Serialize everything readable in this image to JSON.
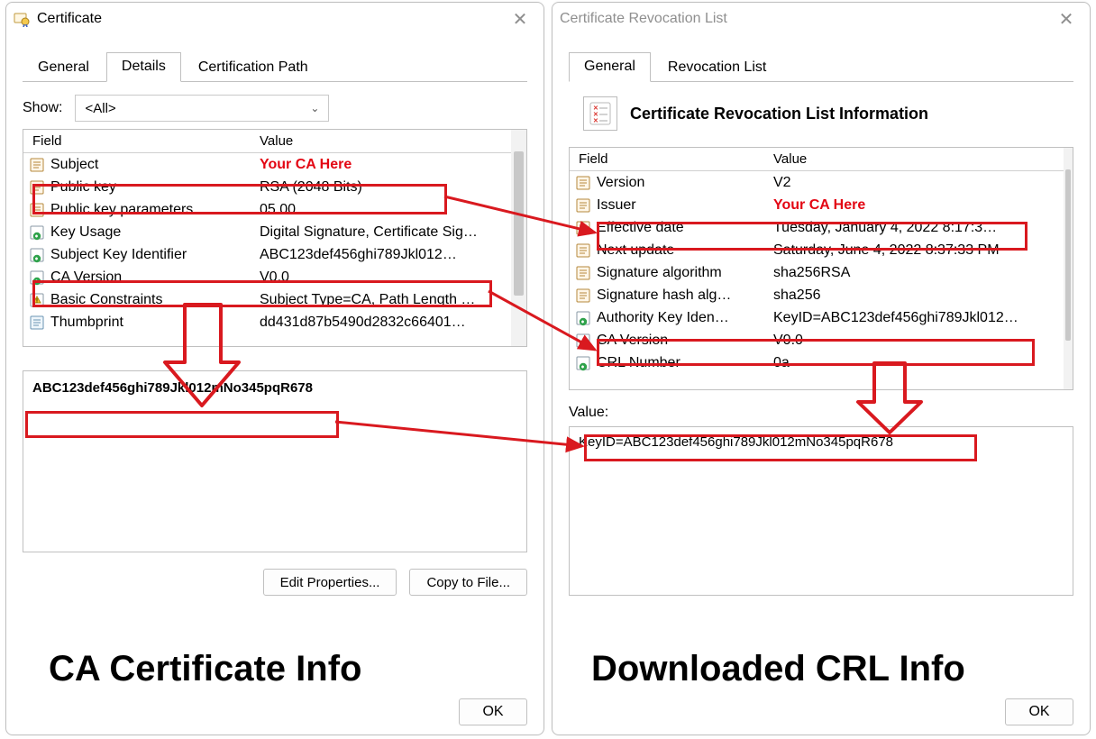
{
  "windows": {
    "cert": {
      "title": "Certificate",
      "tabs": [
        "General",
        "Details",
        "Certification Path"
      ],
      "activeTab": "Details",
      "showLabel": "Show:",
      "showValue": "<All>",
      "cols": {
        "field": "Field",
        "value": "Value"
      },
      "rows": [
        {
          "field": "Subject",
          "value": "Your CA Here",
          "iconType": "doc",
          "red": true
        },
        {
          "field": "Public key",
          "value": "RSA (2048 Bits)",
          "iconType": "doc"
        },
        {
          "field": "Public key parameters",
          "value": "05 00",
          "iconType": "doc"
        },
        {
          "field": "Key Usage",
          "value": "Digital Signature, Certificate Sig…",
          "iconType": "ext"
        },
        {
          "field": "Subject Key Identifier",
          "value": "ABC123def456ghi789Jkl012…",
          "iconType": "ext"
        },
        {
          "field": "CA Version",
          "value": "V0.0",
          "iconType": "ext"
        },
        {
          "field": "Basic Constraints",
          "value": "Subject Type=CA, Path Length …",
          "iconType": "crit"
        },
        {
          "field": "Thumbprint",
          "value": "dd431d87b5490d2832c66401…",
          "iconType": "prop"
        }
      ],
      "valueBox": "ABC123def456ghi789Jkl012mNo345pqR678",
      "buttons": {
        "edit": "Edit Properties...",
        "copy": "Copy to File...",
        "ok": "OK"
      }
    },
    "crl": {
      "title": "Certificate Revocation List",
      "tabs": [
        "General",
        "Revocation List"
      ],
      "activeTab": "General",
      "header": "Certificate Revocation List Information",
      "cols": {
        "field": "Field",
        "value": "Value"
      },
      "rows": [
        {
          "field": "Version",
          "value": "V2",
          "iconType": "doc"
        },
        {
          "field": "Issuer",
          "value": "Your CA Here",
          "iconType": "doc",
          "red": true
        },
        {
          "field": "Effective date",
          "value": "Tuesday, January 4, 2022 8:17:3…",
          "iconType": "doc"
        },
        {
          "field": "Next update",
          "value": "Saturday, June 4, 2022 8:37:33 PM",
          "iconType": "doc"
        },
        {
          "field": "Signature algorithm",
          "value": "sha256RSA",
          "iconType": "doc"
        },
        {
          "field": "Signature hash alg…",
          "value": "sha256",
          "iconType": "doc"
        },
        {
          "field": "Authority Key Iden…",
          "value": "KeyID=ABC123def456ghi789Jkl012…",
          "iconType": "ext"
        },
        {
          "field": "CA Version",
          "value": "V0.0",
          "iconType": "ext"
        },
        {
          "field": "CRL Number",
          "value": "0a",
          "iconType": "ext"
        }
      ],
      "valueLabel": "Value:",
      "valueBox": "KeyID=ABC123def456ghi789Jkl012mNo345pqR678",
      "buttons": {
        "ok": "OK"
      }
    }
  },
  "captions": {
    "left": "CA Certificate Info",
    "right": "Downloaded CRL Info"
  },
  "colors": {
    "annotation": "#d9191f"
  }
}
